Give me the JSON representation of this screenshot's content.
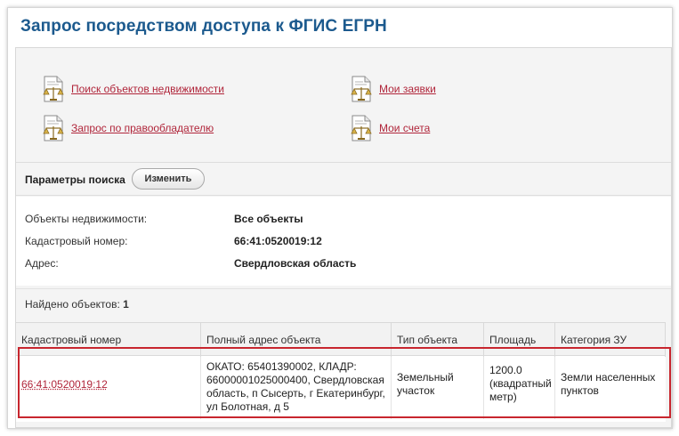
{
  "header": {
    "title": "Запрос посредством доступа к ФГИС ЕГРН"
  },
  "links": [
    {
      "label": "Поиск объектов недвижимости",
      "icon": "document-scales-icon"
    },
    {
      "label": "Мои заявки",
      "icon": "document-scales-icon"
    },
    {
      "label": "Запрос по правообладателю",
      "icon": "document-scales-icon"
    },
    {
      "label": "Мои счета",
      "icon": "document-scales-icon"
    }
  ],
  "params": {
    "label": "Параметры поиска",
    "change_button": "Изменить"
  },
  "info": [
    {
      "key": "Объекты недвижимости:",
      "value": "Все объекты"
    },
    {
      "key": "Кадастровый номер:",
      "value": "66:41:0520019:12"
    },
    {
      "key": "Адрес:",
      "value": "Свердловская область"
    }
  ],
  "found": {
    "label": "Найдено объектов:",
    "count": "1"
  },
  "table": {
    "headers": [
      "Кадастровый номер",
      "Полный адрес объекта",
      "Тип объекта",
      "Площадь",
      "Категория ЗУ"
    ],
    "rows": [
      {
        "cadastral": "66:41:0520019:12",
        "address": "ОКАТО: 65401390002, КЛАДР: 66000001025000400, Свердловская область, п Сысерть, г Екатеринбург, ул Болотная, д 5",
        "type": "Земельный участок",
        "area": "1200.0 (квадратный метр)",
        "category": "Земли населенных пунктов"
      }
    ]
  },
  "colors": {
    "title": "#1c5a8e",
    "link": "#b0253a",
    "highlight": "#c8262e"
  }
}
